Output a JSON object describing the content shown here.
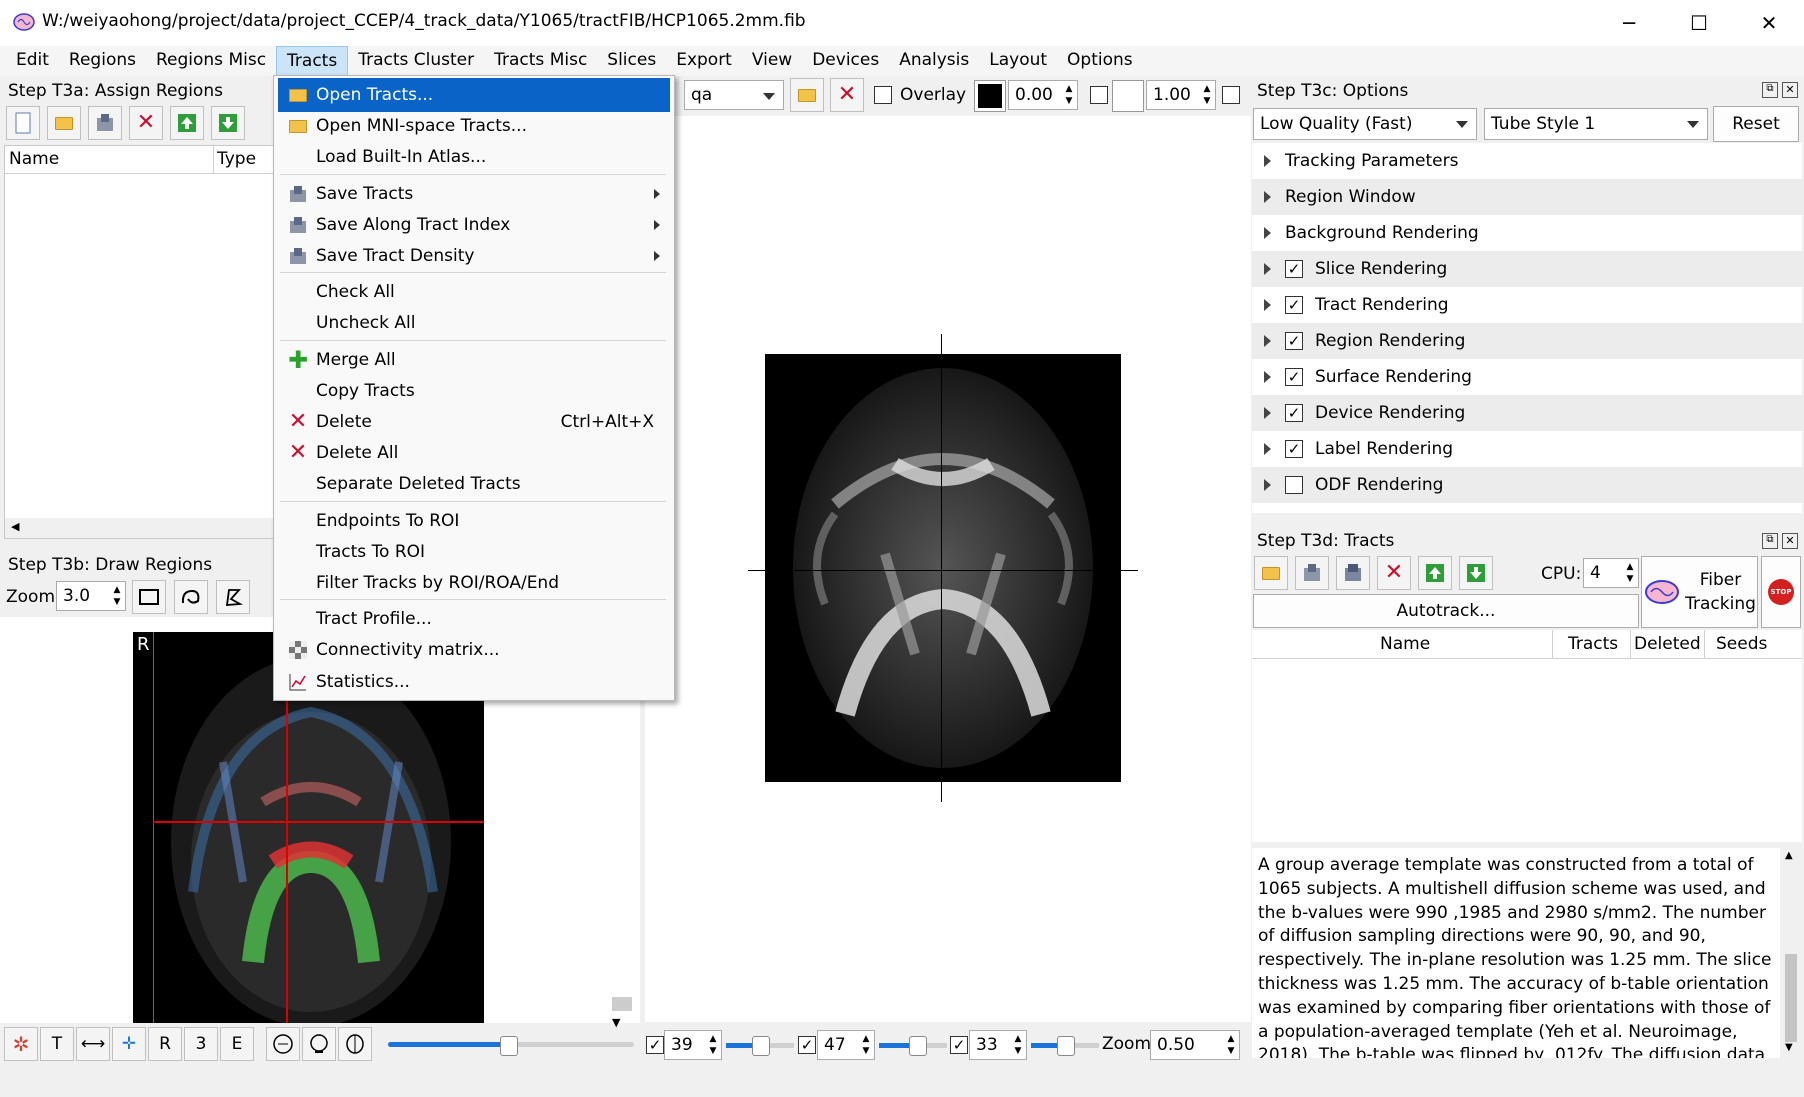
{
  "window": {
    "title": "W:/weiyaohong/project/data/project_CCEP/4_track_data/Y1065/tractFIB/HCP1065.2mm.fib",
    "minimize": "─",
    "maximize": "☐",
    "close": "✕"
  },
  "menubar": [
    "Edit",
    "Regions",
    "Regions Misc",
    "Tracts",
    "Tracts Cluster",
    "Tracts Misc",
    "Slices",
    "Export",
    "View",
    "Devices",
    "Analysis",
    "Layout",
    "Options"
  ],
  "regions_panel": {
    "title": "Step T3a: Assign Regions",
    "col_name": "Name",
    "col_type": "Type"
  },
  "draw_panel": {
    "title": "Step T3b: Draw Regions",
    "zoom_label": "Zoom",
    "zoom_value": "3.0",
    "orient_label": "R"
  },
  "view_toolbar": {
    "slice_value": "qa",
    "overlay_label": "Overlay",
    "min_value": "0.00",
    "max_value": "1.00"
  },
  "options_panel": {
    "title": "Step T3c: Options",
    "quality": "Low Quality (Fast)",
    "style": "Tube Style 1",
    "reset": "Reset",
    "items": [
      {
        "label": "Tracking Parameters",
        "check": null
      },
      {
        "label": "Region Window",
        "check": null
      },
      {
        "label": "Background Rendering",
        "check": null
      },
      {
        "label": "Slice Rendering",
        "check": true
      },
      {
        "label": "Tract Rendering",
        "check": true
      },
      {
        "label": "Region Rendering",
        "check": true
      },
      {
        "label": "Surface Rendering",
        "check": true
      },
      {
        "label": "Device Rendering",
        "check": true
      },
      {
        "label": "Label Rendering",
        "check": true
      },
      {
        "label": "ODF Rendering",
        "check": false
      }
    ]
  },
  "tracts_panel": {
    "title": "Step T3d: Tracts",
    "cpu_label": "CPU:",
    "cpu_value": "4",
    "fiber_tracking_1": "Fiber",
    "fiber_tracking_2": "Tracking",
    "autotrack": "Autotrack...",
    "stop": "STOP",
    "col_name": "Name",
    "col_tracts": "Tracts",
    "col_deleted": "Deleted",
    "col_seeds": "Seeds"
  },
  "description": "A group average template was constructed from a total of 1065 subjects. A multishell diffusion scheme was used, and the b-values were 990 ,1985 and 2980 s/mm2. The number of diffusion sampling directions were 90, 90, and 90, respectively. The in-plane resolution was 1.25 mm. The slice thickness was 1.25 mm. The accuracy of b-table orientation was examined by comparing fiber orientations with those of a population-averaged template (Yeh et al. Neuroimage, 2018). The b-table was flipped by .012fy. The diffusion data were reconstructed in the MNI space using q-",
  "bottom_left_buttons": [
    "T",
    "R",
    "3",
    "E"
  ],
  "bottom_slices": {
    "x": "39",
    "y": "47",
    "z": "33",
    "zoom_label": "Zoom",
    "zoom_value": "0.50"
  },
  "tracts_menu": [
    {
      "label": "Open Tracts...",
      "icon": "folder",
      "hl": true
    },
    {
      "label": "Open MNI-space Tracts...",
      "icon": "folder"
    },
    {
      "label": "Load Built-In Atlas...",
      "icon": ""
    },
    {
      "sep": true
    },
    {
      "label": "Save Tracts",
      "icon": "save",
      "sub": true
    },
    {
      "label": "Save Along Tract Index",
      "icon": "save",
      "sub": true
    },
    {
      "label": "Save Tract Density",
      "icon": "save",
      "sub": true
    },
    {
      "sep": true
    },
    {
      "label": "Check All",
      "icon": ""
    },
    {
      "label": "Uncheck All",
      "icon": ""
    },
    {
      "sep": true
    },
    {
      "label": "Merge All",
      "icon": "plus"
    },
    {
      "label": "Copy Tracts",
      "icon": ""
    },
    {
      "label": "Delete",
      "icon": "x",
      "shortcut": "Ctrl+Alt+X"
    },
    {
      "label": "Delete All",
      "icon": "x"
    },
    {
      "label": "Separate Deleted Tracts",
      "icon": ""
    },
    {
      "sep": true
    },
    {
      "label": "Endpoints To ROI",
      "icon": ""
    },
    {
      "label": "Tracts To ROI",
      "icon": ""
    },
    {
      "label": "Filter Tracks by ROI/ROA/End",
      "icon": ""
    },
    {
      "sep": true
    },
    {
      "label": "Tract Profile...",
      "icon": ""
    },
    {
      "label": "Connectivity matrix...",
      "icon": "matrix"
    },
    {
      "label": "Statistics...",
      "icon": "chart"
    }
  ],
  "colors": {
    "menu_highlight": "#0a64c8",
    "accent": "#1a73d9"
  }
}
